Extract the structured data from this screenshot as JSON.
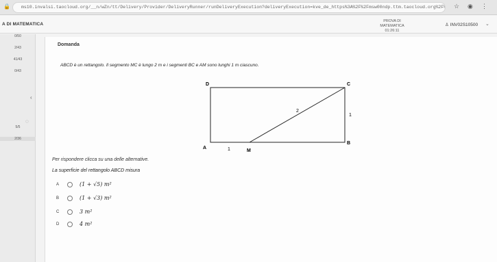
{
  "browser": {
    "url": "ms10.invalsi.taocloud.org/__n/wZn/tt/Delivery/Provider/DeliveryRunner/runDeliveryExecution?deliveryExecution=kve_de_https%3A%2F%2Fmsw00ndp.ttm.taocloud.org%2F%23i1668..."
  },
  "app": {
    "title": "A DI MATEMATICA",
    "exam_label": "PROVA DI MATEMATICA",
    "timer": "01:26:11",
    "user": "INV02S10500"
  },
  "sidebar": {
    "items": [
      "0/50",
      "2/43",
      "41/43",
      "0/43",
      "5/5",
      "2/36"
    ]
  },
  "card": {
    "title": "Domanda",
    "question": "ABCD è un rettangolo. Il segmento MC è lungo 2 m e i segmenti BC e AM sono lunghi 1 m ciascuno.",
    "prompt": "Per rispondere clicca su una delle alternative.",
    "subquestion": "La superficie del rettangolo ABCD misura"
  },
  "figure": {
    "labels": {
      "A": "A",
      "B": "B",
      "C": "C",
      "D": "D",
      "M": "M",
      "mc": "2",
      "bc": "1",
      "am": "1"
    }
  },
  "options": [
    {
      "letter": "A",
      "text": "(1 + √5) m²"
    },
    {
      "letter": "B",
      "text": "(1 + √3) m²"
    },
    {
      "letter": "C",
      "text": "3 m²"
    },
    {
      "letter": "D",
      "text": "4 m²"
    }
  ]
}
